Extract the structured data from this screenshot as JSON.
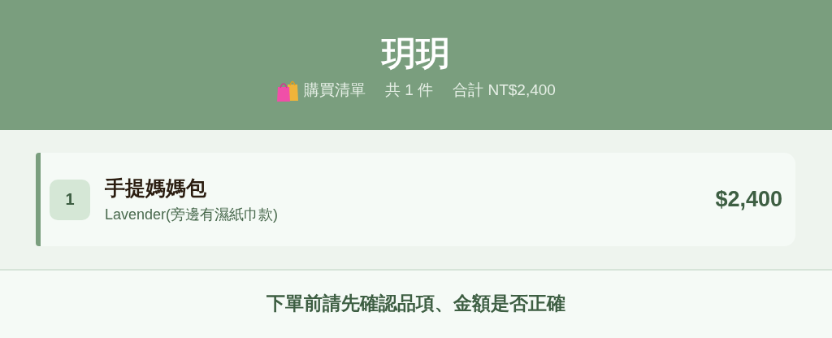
{
  "header": {
    "title": "玥玥",
    "list_label": "購買清單",
    "count": "共 1 件",
    "total": "合計 NT$2,400"
  },
  "items": [
    {
      "index": "1",
      "name": "手提媽媽包",
      "variant": "Lavender(旁邊有濕紙巾款)",
      "price": "$2,400"
    }
  ],
  "footer": {
    "note": "下單前請先確認品項、金額是否正確"
  }
}
